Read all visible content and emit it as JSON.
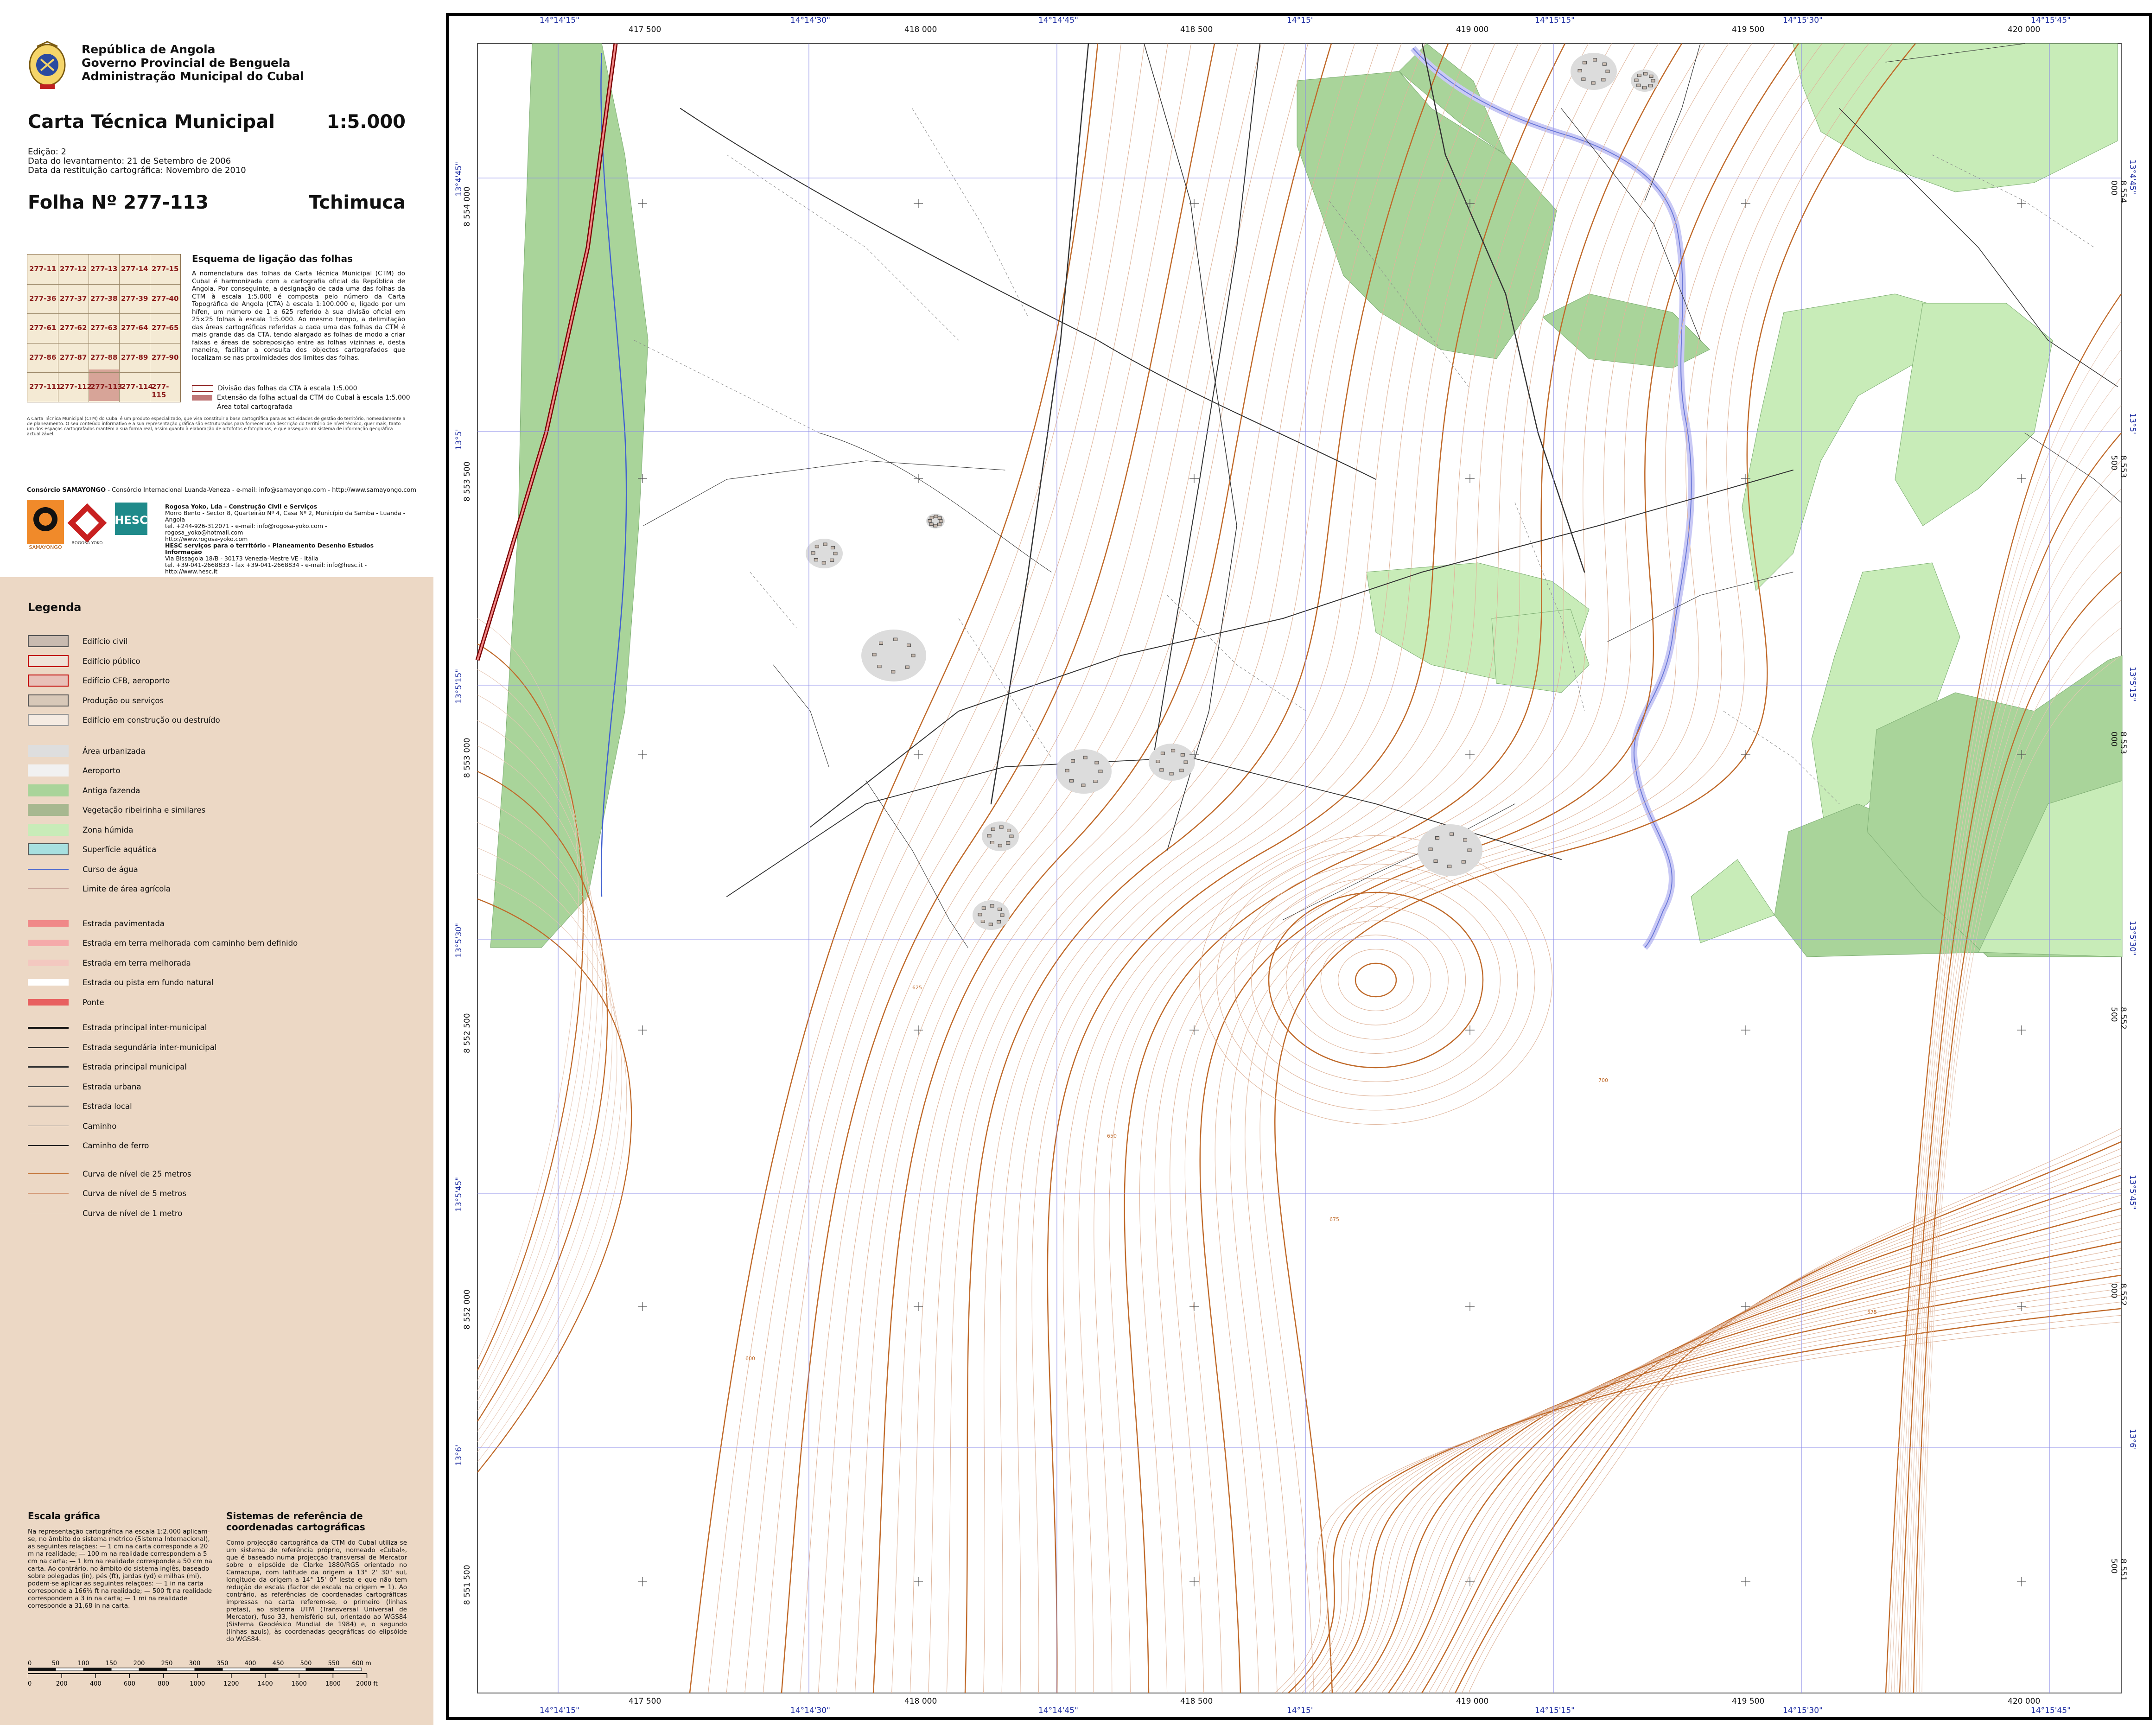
{
  "header": {
    "government": [
      "República de Angola",
      "Governo Provincial de Benguela",
      "Administração Municipal do Cubal"
    ],
    "title": "Carta Técnica Municipal",
    "scale": "1:5.000",
    "meta": [
      "Edição: 2",
      "Data do levantamento: 21 de Setembro de 2006",
      "Data da restituição cartográfica: Novembro de 2010"
    ],
    "sheet_number": "Folha Nº  277-113",
    "sheet_name": "Tchimuca"
  },
  "index_map": {
    "sheets": [
      "277-11",
      "277-12",
      "277-13",
      "277-14",
      "277-15",
      "277-36",
      "277-37",
      "277-38",
      "277-39",
      "277-40",
      "277-61",
      "277-62",
      "277-63",
      "277-64",
      "277-65",
      "277-86",
      "277-87",
      "277-88",
      "277-89",
      "277-90",
      "277-111",
      "277-112",
      "277-113",
      "277-114",
      "277-115"
    ]
  },
  "scheme": {
    "title": "Esquema de ligação das folhas",
    "text": "A nomenclatura das folhas da Carta Técnica Municipal (CTM) do Cubal é harmonizada com a cartografia oficial da República de Angola. Por conseguinte, a designação de cada uma das folhas da CTM à escala 1:5.000 é composta pelo número da Carta Topográfica de Angola (CTA) à escala 1:100.000 e, ligado por um hífen, um número de 1 a 625 referido à sua divisão oficial em 25×25 folhas à escala 1:5.000. Ao mesmo tempo, a delimitação das áreas cartográficas referidas a cada uma das folhas da CTM é mais grande das da CTA, tendo alargado as folhas de modo a criar faixas e áreas de sobreposição entre as folhas vizinhas e, desta maneira, facilitar a consulta dos objectos cartografados que localizam-se nas proximidades dos limites das folhas.",
    "legend": [
      "Divisão das folhas da CTA à escala 1:5.000",
      "Extensão da folha actual da CTM do Cubal à escala 1:5.000",
      "Área total cartografada"
    ]
  },
  "fine_print": "A Carta Técnica Municipal (CTM) do Cubal é um produto especializado, que visa constituir a base cartográfica para as actividades de gestão do território, nomeadamente a de planeamento. O seu conteúdo informativo e a sua representação gráfica são estruturados para fornecer uma descrição do território de nível técnico, quer mais, tanto um dos espaços cartografados mantém a sua forma real, assim quanto à elaboração de ortofotos e fotoplanos, e que assegura um sistema de informação geográfica actualizável.",
  "consortium": {
    "title": "Consórcio SAMAYONGO",
    "line": " - Consórcio Internacional Luanda-Veneza - e-mail: info@samayongo.com - http://www.samayongo.com",
    "partners": [
      "Rogosa Yoko, Lda - Construção Civil e Serviços",
      "Morro Bento - Sector 8, Quarteirão Nº 4, Casa Nº 2, Município da Samba - Luanda - Angola",
      "tel. +244-926-312071 - e-mail: info@rogosa-yoko.com - rogosa_yoko@hotmail.com",
      "http://www.rogosa-yoko.com",
      "HESC serviços para o território - Planeamento Desenho Estudos Informação",
      "Via Bissagola 18/B - 30173 Venezia-Mestre VE - Itália",
      "tel. +39-041-2668833 - fax +39-041-2668834 - e-mail: info@hesc.it - http://www.hesc.it"
    ],
    "logo_labels": [
      "SAMAYONGO",
      "ROGOSA YOKO",
      "HESC"
    ]
  },
  "legend": {
    "title": "Legenda",
    "items": [
      {
        "label": "Edifício civil",
        "fill": "#c9bbb0",
        "stroke": "#555",
        "type": "box"
      },
      {
        "label": "Edifício público",
        "fill": "#efe3d8",
        "stroke": "#c00000",
        "type": "box"
      },
      {
        "label": "Edifício CFB, aeroporto",
        "fill": "#e8c0b8",
        "stroke": "#c00000",
        "type": "box"
      },
      {
        "label": "Produção ou serviços",
        "fill": "#d8c8b8",
        "stroke": "#555",
        "type": "box"
      },
      {
        "label": "Edifício em construção ou destruído",
        "fill": "#f5ebe2",
        "stroke": "#999",
        "type": "box"
      },
      {
        "label": "Área urbanizada",
        "fill": "#dedede",
        "stroke": "#dedede",
        "type": "box"
      },
      {
        "label": "Aeroporto",
        "fill": "#f1f1f1",
        "stroke": "#f1f1f1",
        "type": "box"
      },
      {
        "label": "Antiga fazenda",
        "fill": "#a9d49a",
        "stroke": "#a9d49a",
        "type": "box"
      },
      {
        "label": "Vegetação ribeirinha e similares",
        "fill": "#a7b890",
        "stroke": "#a7b890",
        "type": "box"
      },
      {
        "label": "Zona húmida",
        "fill": "#c8ecb8",
        "stroke": "#c8ecb8",
        "type": "box"
      },
      {
        "label": "Superfície aquática",
        "fill": "#a8e0e0",
        "stroke": "#555",
        "type": "box"
      },
      {
        "label": "Curso de água",
        "color": "#4060d0",
        "width": 2,
        "type": "line"
      },
      {
        "label": "Limite de área agrícola",
        "color": "#caa59a",
        "width": 1,
        "type": "line"
      },
      {
        "label": "Estrada pavimentada",
        "fill": "#f08888",
        "stroke": "#f08888",
        "type": "road"
      },
      {
        "label": "Estrada em terra melhorada com caminho bem definido",
        "fill": "#f5aaaa",
        "stroke": "#f5aaaa",
        "type": "road"
      },
      {
        "label": "Estrada em terra melhorada",
        "fill": "#f3c8c0",
        "stroke": "#f3c8c0",
        "type": "road"
      },
      {
        "label": "Estrada ou pista em fundo natural",
        "fill": "#ffffff",
        "stroke": "#ffffff",
        "type": "road"
      },
      {
        "label": "Ponte",
        "fill": "#e86060",
        "stroke": "#e86060",
        "type": "road"
      },
      {
        "label": "Estrada principal inter-municipal",
        "color": "#111",
        "width": 4,
        "type": "line"
      },
      {
        "label": "Estrada segundária inter-municipal",
        "color": "#222",
        "width": 3,
        "type": "line"
      },
      {
        "label": "Estrada principal municipal",
        "color": "#333",
        "width": 3,
        "type": "line"
      },
      {
        "label": "Estrada urbana",
        "color": "#555",
        "width": 2,
        "type": "line"
      },
      {
        "label": "Estrada local",
        "color": "#555",
        "width": 1.5,
        "type": "line"
      },
      {
        "label": "Caminho",
        "color": "#999",
        "width": 1,
        "type": "line"
      },
      {
        "label": "Caminho de ferro",
        "color": "#222",
        "width": 2,
        "type": "line"
      },
      {
        "label": "Curva de nível de 25 metros",
        "color": "#c06a2a",
        "width": 2.5,
        "type": "line"
      },
      {
        "label": "Curva de nível de 5 metros",
        "color": "#d49a78",
        "width": 1.5,
        "type": "line"
      },
      {
        "label": "Curva de nível de 1 metro",
        "color": "#e8c8b8",
        "width": 1,
        "type": "line"
      }
    ]
  },
  "scale_section": {
    "title": "Escala gráfica",
    "text": "Na representação cartográfica na escala 1:2.000 aplicam-se, no âmbito do sistema métrico (Sistema Internacional), as seguintes relações: — 1 cm na carta corresponde a 20 m na realidade; — 100 m na realidade correspondem a 5 cm na carta; — 1 km na realidade corresponde a 50 cm na carta. Ao contrário, no âmbito do sistema inglês, baseado sobre polegadas (in), pés (ft), jardas (yd) e milhas (mi), podem-se aplicar as seguintes relações: — 1 in na carta corresponde a 166⅔ ft na realidade; — 500 ft na realidade correspondem a 3 in na carta; — 1 mi na realidade corresponde a 31,68 in na carta.",
    "metres_ticks": [
      "0",
      "50",
      "100",
      "150",
      "200",
      "250",
      "300",
      "350",
      "400",
      "450",
      "500",
      "550",
      "600 m"
    ],
    "feet_ticks": [
      "0",
      "200",
      "400",
      "600",
      "800",
      "1000",
      "1200",
      "1400",
      "1600",
      "1800",
      "2000 ft"
    ]
  },
  "crs_section": {
    "title": "Sistemas de referência de coordenadas cartográficas",
    "text": "Como projecção cartográfica da CTM do Cubal utiliza-se um sistema de referência próprio, nomeado «Cubal», que é baseado numa projecção transversal de Mercator sobre o elipsóide de Clarke 1880/RGS orientado no Camacupa, com latitude da origem a 13° 2' 30\" sul, longitude da origem a 14° 15' 0\" leste e que não tem redução de escala (factor de escala na origem = 1). Ao contrário, as referências de coordenadas cartográficas impressas na carta referem-se, o primeiro (linhas pretas), ao sistema UTM (Transversal Universal de Mercator), fuso 33, hemisfério sul, orientado ao WGS84 (Sistema Geodésico Mundial de 1984) e, o segundo (linhas azuis), às coordenadas geográficas do elipsóide do WGS84."
  },
  "map": {
    "top_geo": [
      "14°14'15\"",
      "14°14'30\"",
      "14°14'45\"",
      "14°15'",
      "14°15'15\"",
      "14°15'30\"",
      "14°15'45\""
    ],
    "top_utm": [
      "417 500",
      "418 000",
      "418 500",
      "419 000",
      "419 500",
      "420 000"
    ],
    "side_utm": [
      "8 554 000",
      "8 553 500",
      "8 553 000",
      "8 552 500",
      "8 552 000",
      "8 551 500"
    ],
    "side_geo": [
      "13°4'45\"",
      "13°5'",
      "13°5'15\"",
      "13°5'30\"",
      "13°5'45\"",
      "13°6'"
    ],
    "contour_labels": [
      "625",
      "650",
      "675",
      "700",
      "600",
      "575"
    ]
  }
}
